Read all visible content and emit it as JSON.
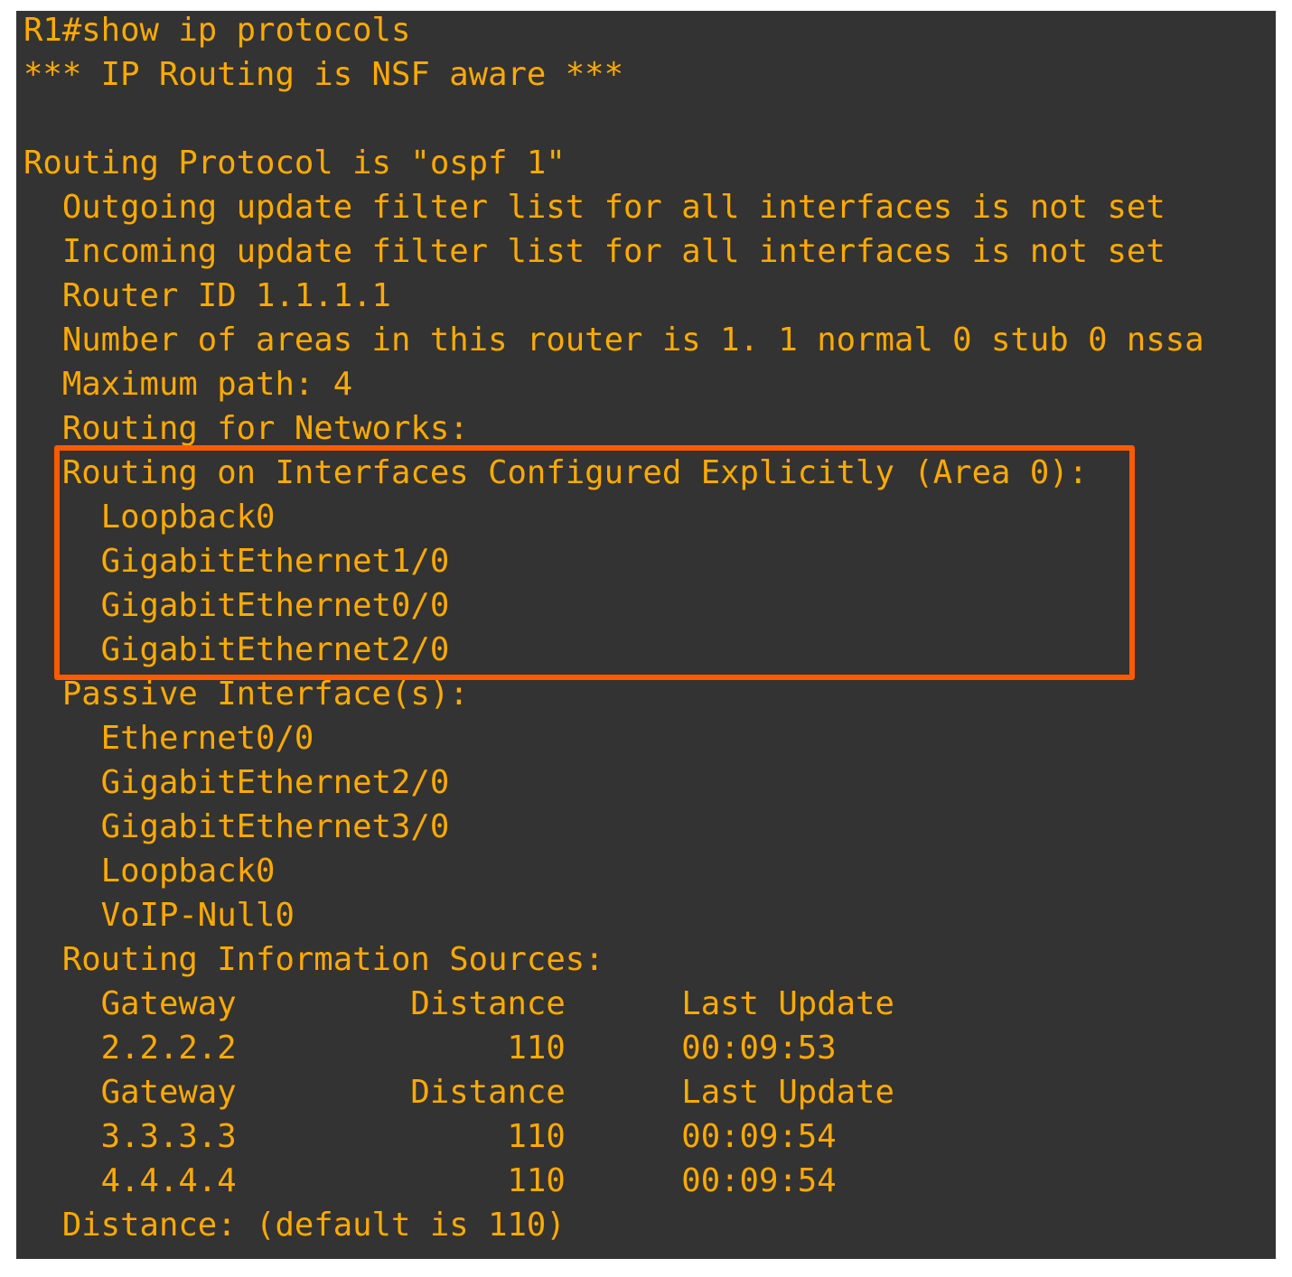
{
  "terminal": {
    "lines": [
      "R1#show ip protocols",
      "*** IP Routing is NSF aware ***",
      "",
      "Routing Protocol is \"ospf 1\"",
      "  Outgoing update filter list for all interfaces is not set",
      "  Incoming update filter list for all interfaces is not set",
      "  Router ID 1.1.1.1",
      "  Number of areas in this router is 1. 1 normal 0 stub 0 nssa",
      "  Maximum path: 4",
      "  Routing for Networks:",
      "  Routing on Interfaces Configured Explicitly (Area 0):",
      "    Loopback0",
      "    GigabitEthernet1/0",
      "    GigabitEthernet0/0",
      "    GigabitEthernet2/0",
      "  Passive Interface(s):",
      "    Ethernet0/0",
      "    GigabitEthernet2/0",
      "    GigabitEthernet3/0",
      "    Loopback0",
      "    VoIP-Null0",
      "  Routing Information Sources:",
      "    Gateway         Distance      Last Update",
      "    2.2.2.2              110      00:09:53",
      "    Gateway         Distance      Last Update",
      "    3.3.3.3              110      00:09:54",
      "    4.4.4.4              110      00:09:54",
      "  Distance: (default is 110)"
    ]
  },
  "colors": {
    "background": "#333333",
    "text": "#ffaa00",
    "highlight_border": "#ff5a00"
  }
}
